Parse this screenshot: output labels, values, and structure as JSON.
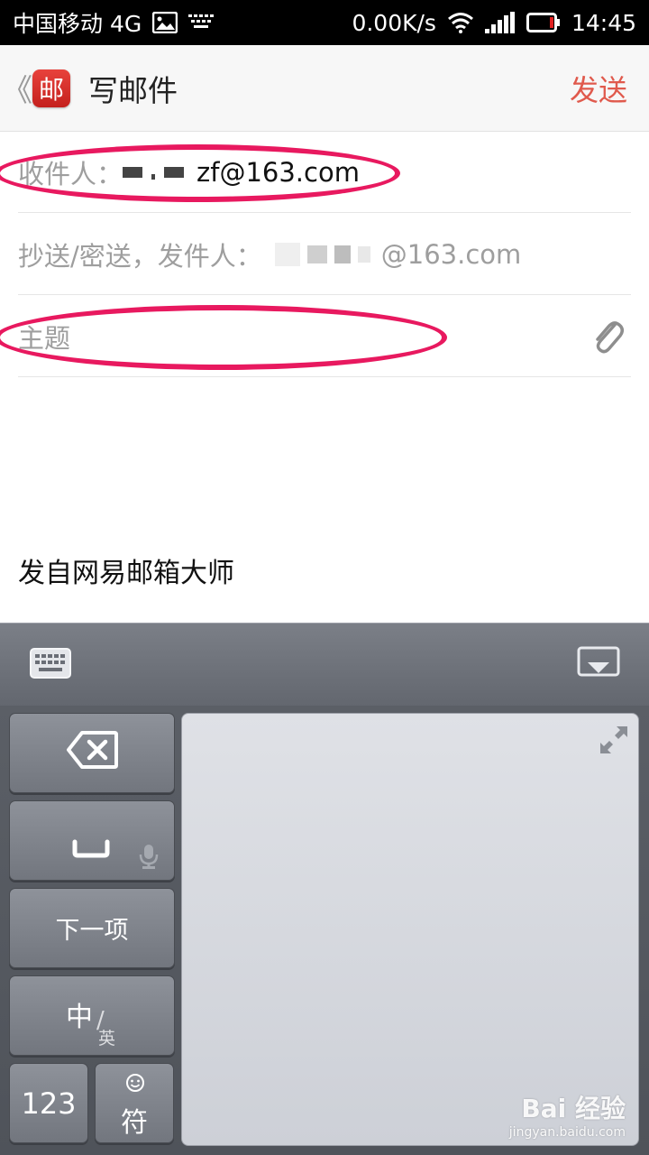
{
  "status_bar": {
    "carrier": "中国移动 4G",
    "network_speed": "0.00K/s",
    "time": "14:45",
    "icons": [
      "image-notification-icon",
      "keyboard-notification-icon",
      "wifi-icon",
      "signal-icon",
      "battery-icon"
    ]
  },
  "app_bar": {
    "back_glyph": "《",
    "logo_char": "邮",
    "title": "写邮件",
    "send_label": "发送"
  },
  "form": {
    "to_label": "收件人：",
    "to_value": "zf@163.com",
    "cc_label": "抄送/密送，发件人：",
    "cc_value": "@163.com",
    "subject_placeholder": "主题",
    "signature": "发自网易邮箱大师"
  },
  "keyboard": {
    "next_label": "下一项",
    "lang_main": "中",
    "lang_sub": "英",
    "num_label": "123",
    "symbol_label": "符"
  },
  "watermark": {
    "main": "Bai 经验",
    "sub": "jingyan.baidu.com"
  },
  "colors": {
    "send_accent": "#e05a4d",
    "logo_red": "#d42f2a",
    "highlight_ellipse": "#e8195f"
  }
}
